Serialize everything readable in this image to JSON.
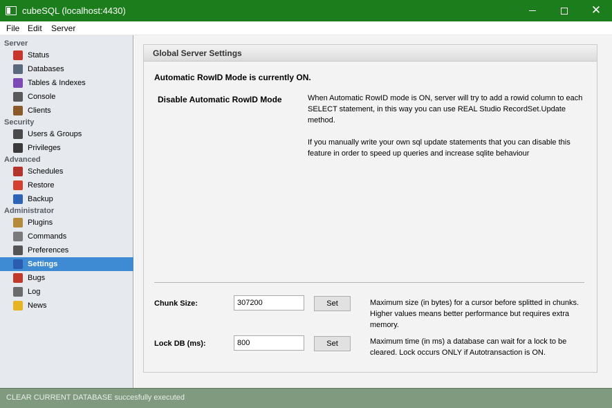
{
  "window": {
    "title": "cubeSQL (localhost:4430)",
    "minimize_glyph": "",
    "maximize_glyph": "",
    "close_glyph": "✕"
  },
  "menu": [
    "File",
    "Edit",
    "Server"
  ],
  "sidebar": {
    "sections": [
      {
        "title": "Server",
        "items": [
          {
            "label": "Status",
            "icon": "chart-icon",
            "color": "#c9352b"
          },
          {
            "label": "Databases",
            "icon": "database-icon",
            "color": "#596a7c"
          },
          {
            "label": "Tables & Indexes",
            "icon": "table-icon",
            "color": "#7d4ab5"
          },
          {
            "label": "Console",
            "icon": "console-icon",
            "color": "#5a5a5a"
          },
          {
            "label": "Clients",
            "icon": "clients-icon",
            "color": "#8a5a2b"
          }
        ]
      },
      {
        "title": "Security",
        "items": [
          {
            "label": "Users & Groups",
            "icon": "users-icon",
            "color": "#4a4a4a"
          },
          {
            "label": "Privileges",
            "icon": "traffic-light-icon",
            "color": "#3a3a3a"
          }
        ]
      },
      {
        "title": "Advanced",
        "items": [
          {
            "label": "Schedules",
            "icon": "calendar-icon",
            "color": "#b3352b"
          },
          {
            "label": "Restore",
            "icon": "lifebuoy-icon",
            "color": "#d4402f"
          },
          {
            "label": "Backup",
            "icon": "umbrella-icon",
            "color": "#2e64b8"
          }
        ]
      },
      {
        "title": "Administrator",
        "items": [
          {
            "label": "Plugins",
            "icon": "plugin-icon",
            "color": "#b58a3a"
          },
          {
            "label": "Commands",
            "icon": "commands-icon",
            "color": "#7a7a7a"
          },
          {
            "label": "Preferences",
            "icon": "tools-icon",
            "color": "#555555"
          },
          {
            "label": "Settings",
            "icon": "monitor-icon",
            "color": "#2a5db0",
            "selected": true
          },
          {
            "label": "Bugs",
            "icon": "bug-icon",
            "color": "#c0392b"
          },
          {
            "label": "Log",
            "icon": "log-icon",
            "color": "#6b6b6b"
          },
          {
            "label": "News",
            "icon": "lightbulb-icon",
            "color": "#e6b422"
          }
        ]
      }
    ]
  },
  "panel": {
    "title": "Global Server Settings",
    "rowid_status": "Automatic RowID Mode is currently ON.",
    "rowid_toggle": "Disable Automatic RowID Mode",
    "rowid_desc_1": "When Automatic RowID mode is ON, server will try to add a rowid column to each SELECT statement, in this way you can use REAL Studio RecordSet.Update method.",
    "rowid_desc_2": "If you manually write your own sql update statements that you can disable this feature in order to speed up queries and increase sqlite behaviour",
    "chunk_label": "Chunk Size:",
    "chunk_value": "307200",
    "chunk_help": "Maximum size (in bytes) for a cursor before splitted in chunks. Higher values means better performance but requires extra memory.",
    "lock_label": "Lock DB (ms):",
    "lock_value": "800",
    "lock_help": "Maximum time (in ms) a database can wait for a lock to be cleared. Lock occurs ONLY if Autotransaction is ON.",
    "set_label": "Set"
  },
  "status": {
    "text": "CLEAR CURRENT DATABASE succesfully executed"
  },
  "colors": {
    "titlebar": "#1b7d1b",
    "selected": "#3e8ad3",
    "statusbar": "#7f9a7f"
  }
}
